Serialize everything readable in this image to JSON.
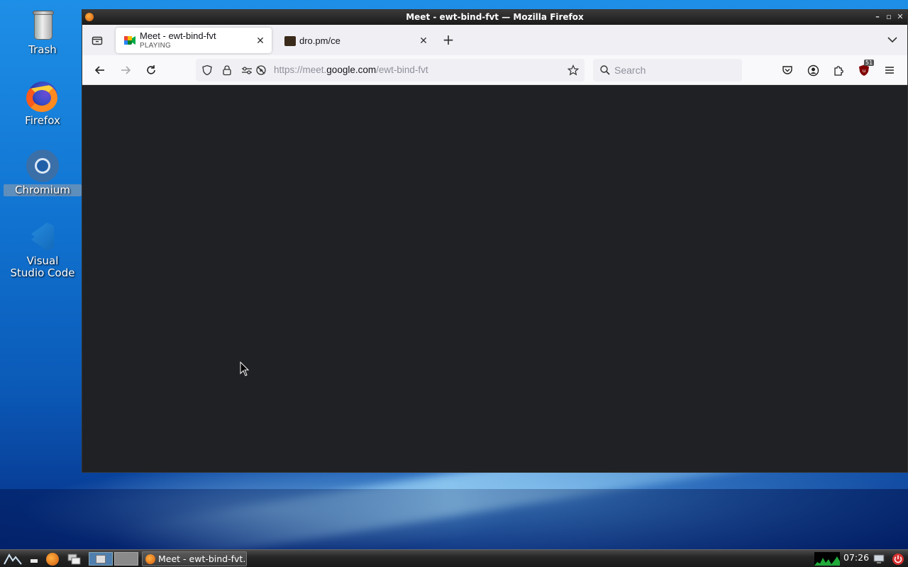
{
  "desktop": {
    "icons": [
      {
        "label": "Trash"
      },
      {
        "label": "Firefox"
      },
      {
        "label": "Chromium"
      },
      {
        "label": "Visual Studio Code"
      }
    ]
  },
  "window": {
    "title": "Meet - ewt-bind-fvt — Mozilla Firefox"
  },
  "tabs": [
    {
      "title": "Meet - ewt-bind-fvt",
      "subtitle": "PLAYING",
      "active": true
    },
    {
      "title": "dro.pm/ce",
      "active": false
    }
  ],
  "navbar": {
    "url_scheme": "https://meet.",
    "url_host": "google.com",
    "url_path": "/ewt-bind-fvt",
    "search_placeholder": "Search",
    "extension_badge": "51"
  },
  "taskbar": {
    "window_button": "Meet - ewt-bind-fvt...",
    "clock": "07:26"
  },
  "colors": {
    "content_bg": "#202124",
    "toolbar_bg": "#f9f9fb",
    "tabbar_bg": "#f0f0f4"
  }
}
